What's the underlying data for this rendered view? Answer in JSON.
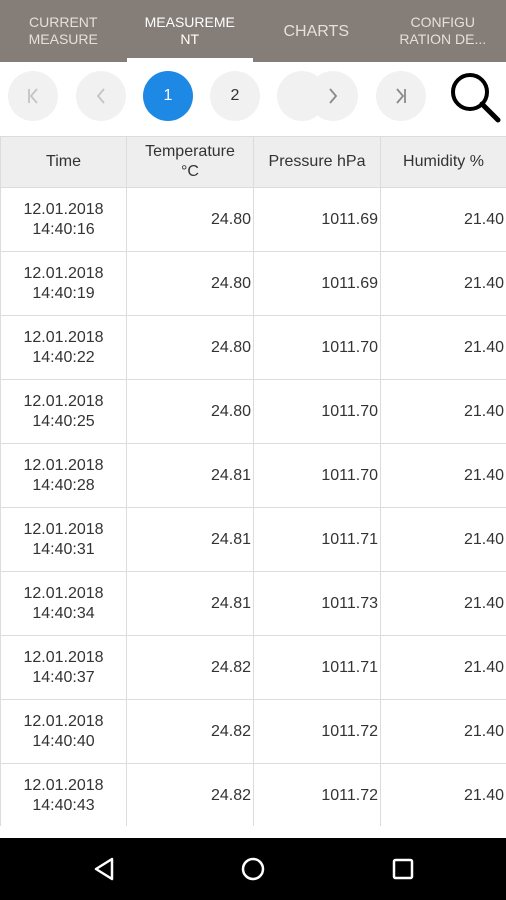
{
  "tabs": [
    {
      "label": "CURRENT\nMEASURE",
      "active": false
    },
    {
      "label": "MEASUREME\nNT",
      "active": true
    },
    {
      "label": "CHARTS",
      "active": false
    },
    {
      "label": "CONFIGU\nRATION DE...",
      "active": false
    }
  ],
  "pager": {
    "first_icon": "first-page-icon",
    "prev_icon": "previous-page-icon",
    "pages": [
      "1",
      "2"
    ],
    "current_page": "1",
    "next_icon": "next-page-icon",
    "last_icon": "last-page-icon",
    "search_icon": "search-icon"
  },
  "table": {
    "headers": [
      "Time",
      "Temperature\n°C",
      "Pressure hPa",
      "Humidity %"
    ],
    "rows": [
      {
        "date": "12.01.2018",
        "time": "14:40:16",
        "temperature": "24.80",
        "pressure": "1011.69",
        "humidity": "21.40"
      },
      {
        "date": "12.01.2018",
        "time": "14:40:19",
        "temperature": "24.80",
        "pressure": "1011.69",
        "humidity": "21.40"
      },
      {
        "date": "12.01.2018",
        "time": "14:40:22",
        "temperature": "24.80",
        "pressure": "1011.70",
        "humidity": "21.40"
      },
      {
        "date": "12.01.2018",
        "time": "14:40:25",
        "temperature": "24.80",
        "pressure": "1011.70",
        "humidity": "21.40"
      },
      {
        "date": "12.01.2018",
        "time": "14:40:28",
        "temperature": "24.81",
        "pressure": "1011.70",
        "humidity": "21.40"
      },
      {
        "date": "12.01.2018",
        "time": "14:40:31",
        "temperature": "24.81",
        "pressure": "1011.71",
        "humidity": "21.40"
      },
      {
        "date": "12.01.2018",
        "time": "14:40:34",
        "temperature": "24.81",
        "pressure": "1011.73",
        "humidity": "21.40"
      },
      {
        "date": "12.01.2018",
        "time": "14:40:37",
        "temperature": "24.82",
        "pressure": "1011.71",
        "humidity": "21.40"
      },
      {
        "date": "12.01.2018",
        "time": "14:40:40",
        "temperature": "24.82",
        "pressure": "1011.72",
        "humidity": "21.40"
      },
      {
        "date": "12.01.2018",
        "time": "14:40:43",
        "temperature": "24.82",
        "pressure": "1011.72",
        "humidity": "21.40"
      }
    ]
  },
  "navbar": {
    "back_icon": "back-triangle-icon",
    "home_icon": "home-circle-icon",
    "recents_icon": "recents-square-icon"
  },
  "colors": {
    "tabbar": "#857d78",
    "accent": "#1e88e5",
    "header_bg": "#eeeeee"
  }
}
